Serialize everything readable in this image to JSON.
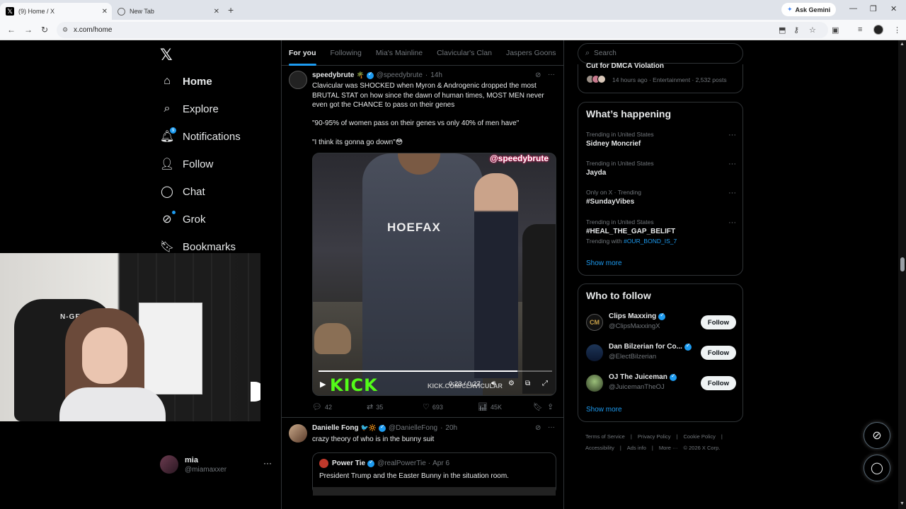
{
  "browser": {
    "tabs": [
      {
        "title": "(9) Home / X"
      },
      {
        "title": "New Tab"
      }
    ],
    "new_tab_label": "+",
    "ask_gemini": "Ask Gemini",
    "url": "x.com/home"
  },
  "nav": {
    "items": [
      {
        "label": "Home",
        "icon": "home-icon"
      },
      {
        "label": "Explore",
        "icon": "search-icon"
      },
      {
        "label": "Notifications",
        "icon": "bell-icon",
        "badge": "9"
      },
      {
        "label": "Follow",
        "icon": "person-add-icon"
      },
      {
        "label": "Chat",
        "icon": "chat-icon"
      },
      {
        "label": "Grok",
        "icon": "grok-icon"
      },
      {
        "label": "Bookmarks",
        "icon": "bookmark-icon"
      }
    ],
    "user": {
      "name": "mia",
      "handle": "@miamaxxer"
    }
  },
  "feed": {
    "tabs": [
      "For you",
      "Following",
      "Mia's Mainline",
      "Clavicular's Clan",
      "Jaspers Goons"
    ],
    "tweets": [
      {
        "name": "speedybrute",
        "handle": "@speedybrute",
        "time": "14h",
        "text1": "Clavicular was SHOCKED when Myron & Androgenic dropped the most BRUTAL STAT on how since the dawn of human times, MOST MEN never even got the CHANCE to pass on their genes",
        "text2": "\"90-95% of women pass on their genes vs only 40% of men have\"",
        "text3": "\"I think its gonna go down\"😳",
        "video": {
          "watermark": "@speedybrute",
          "hoodie_text": "HOEFAX",
          "kick_logo": "KICK",
          "kick_url": "KICK.COM/CLAVICULAR",
          "time": "0:23 / 0:27",
          "progress": 0.85
        },
        "stats": {
          "replies": "42",
          "reposts": "35",
          "likes": "693",
          "views": "45K"
        }
      },
      {
        "name": "Danielle Fong",
        "name_emoji": "🐦🔆",
        "handle": "@DanielleFong",
        "time": "20h",
        "text": "crazy theory of who is in the bunny suit",
        "quote": {
          "name": "Power Tie",
          "handle": "@realPowerTie",
          "time": "Apr 6",
          "text": "President Trump and the Easter Bunny in the situation room."
        }
      }
    ]
  },
  "sidebar": {
    "search_placeholder": "Search",
    "top_card": {
      "title": "Cut for DMCA Violation",
      "meta": "14 hours ago · Entertainment · 2,532 posts"
    },
    "whats_happening": {
      "title": "What’s happening",
      "trends": [
        {
          "context": "Trending in United States",
          "topic": "Sidney Moncrief"
        },
        {
          "context": "Trending in United States",
          "topic": "Jayda"
        },
        {
          "context": "Only on X · Trending",
          "topic": "#SundayVibes"
        },
        {
          "context": "Trending in United States",
          "topic": "#HEAL_THE_GAP_BELIFT",
          "with_label": "Trending with",
          "with_tag": "#OUR_BOND_IS_7"
        }
      ],
      "show_more": "Show more"
    },
    "who_to_follow": {
      "title": "Who to follow",
      "accounts": [
        {
          "name": "Clips Maxxing",
          "handle": "@ClipsMaxxingX",
          "button": "Follow"
        },
        {
          "name": "Dan Bilzerian for Co...",
          "handle": "@ElectBilzerian",
          "button": "Follow"
        },
        {
          "name": "OJ The Juiceman",
          "handle": "@JuicemanTheOJ",
          "button": "Follow"
        }
      ],
      "show_more": "Show more"
    },
    "footer": {
      "links": [
        "Terms of Service",
        "Privacy Policy",
        "Cookie Policy",
        "Accessibility",
        "Ads info",
        "More ···"
      ],
      "copyright": "© 2026 X Corp."
    }
  },
  "webcam": {
    "chair_logo": "N-GEN"
  },
  "colors": {
    "accent": "#1d9bf0",
    "background": "#000000",
    "border": "#2f3336",
    "muted": "#71767b",
    "kick_green": "#53fc18"
  }
}
